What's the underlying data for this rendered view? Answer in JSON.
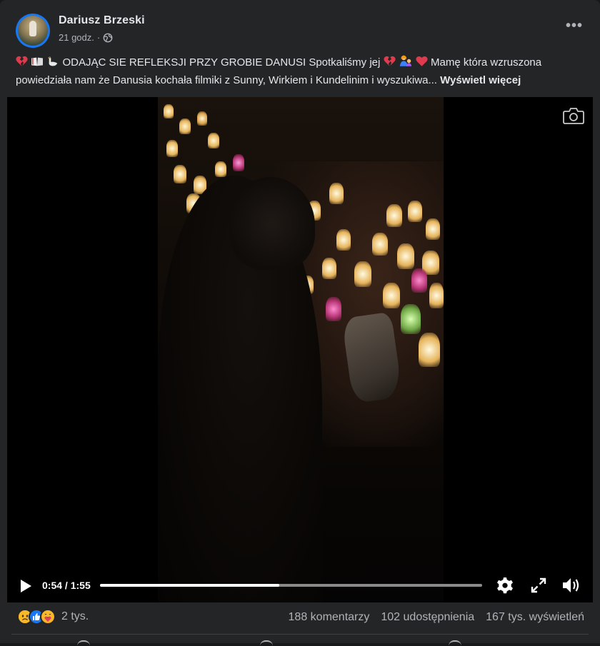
{
  "post": {
    "author": "Dariusz Brzeski",
    "time": "21 godz.",
    "privacy_icon": "globe-icon",
    "more_label": "•••",
    "caption_prefix_emojis": [
      "broken-heart",
      "book",
      "goose"
    ],
    "caption_text_1": "ODAJĄC SIE REFLEKSJI PRZY GROBIE DANUSI Spotkaliśmy jej",
    "caption_mid_emojis": [
      "broken-heart",
      "woman-holding-child",
      "red-heart"
    ],
    "caption_text_2": "Mamę która wzruszona powiedziała nam że Danusia kochała filmiki z Sunny, Wirkiem i Kundelinim i wyszukiwa...",
    "see_more": "Wyświetl więcej"
  },
  "video": {
    "current_time": "0:54",
    "separator": "/",
    "duration": "1:55",
    "progress_fraction": 0.47
  },
  "footer": {
    "reaction_icons": [
      "sad",
      "like",
      "care"
    ],
    "reaction_count": "2 tys.",
    "comments": "188 komentarzy",
    "shares": "102 udostępnienia",
    "views": "167 tys. wyświetleń"
  },
  "colors": {
    "background": "#242526",
    "text_primary": "#e4e6eb",
    "text_secondary": "#b0b3b8",
    "accent_blue": "#1877f2"
  }
}
